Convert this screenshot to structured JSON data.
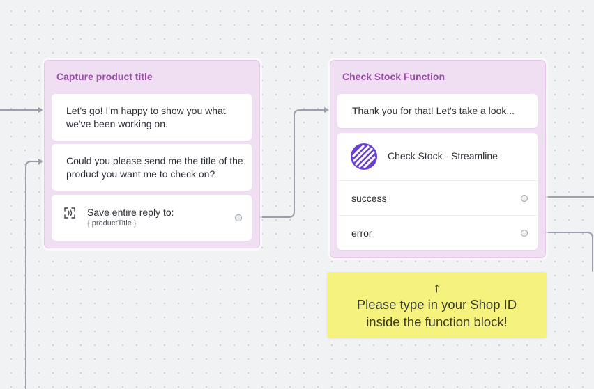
{
  "canvas": {
    "background": "#f1f2f4",
    "wire_color": "#9aa1ac"
  },
  "blocks": {
    "capture": {
      "title": "Capture product title",
      "messages": [
        "Let's go! I'm happy to show you what we've been working on.",
        "Could you please send me the title of the product you want me to check on?"
      ],
      "capture_step": {
        "label": "Save entire reply to:",
        "variable": "productTitle",
        "icon": "capture-reply-icon"
      }
    },
    "check_stock": {
      "title": "Check Stock Function",
      "message": "Thank you for that! Let's take a look...",
      "function": {
        "name": "Check Stock - Streamline",
        "icon": "streamline-logo-icon",
        "logo_color": "#6b3fd4"
      },
      "paths": [
        "success",
        "error"
      ]
    }
  },
  "note": {
    "arrow": "↑",
    "lines": [
      "Please type in your Shop ID",
      "inside the function block!"
    ],
    "color": "#f5f27e"
  }
}
